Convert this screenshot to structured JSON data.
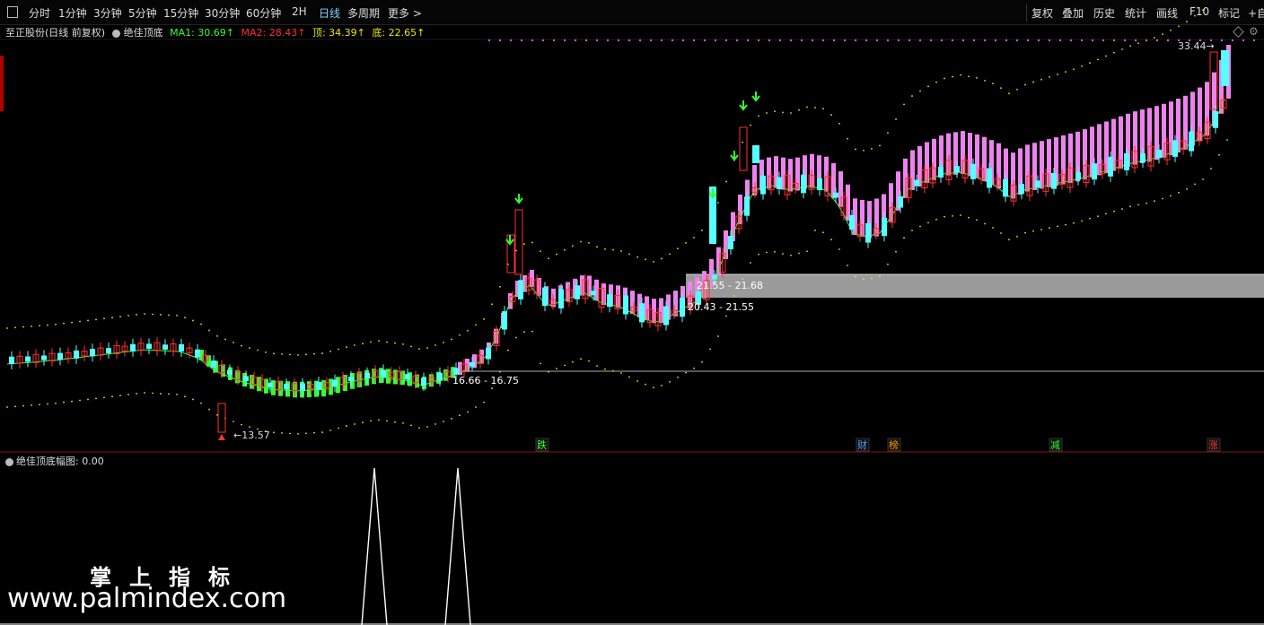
{
  "toolbar": {
    "periods": [
      "分时",
      "1分钟",
      "3分钟",
      "5分钟",
      "15分钟",
      "30分钟",
      "60分钟",
      "2H",
      "日线",
      "多周期",
      "更多 >"
    ],
    "active_period": "日线",
    "right_buttons": [
      "复权",
      "叠加",
      "历史",
      "统计",
      "画线",
      "F10",
      "标记",
      "+自"
    ]
  },
  "info": {
    "stock_name": "至正股份(日线 前复权)",
    "indicator": "绝佳顶底",
    "ma1": "MA1: 30.69↑",
    "ma2": "MA2: 28.43↑",
    "top": "顶: 34.39↑",
    "bottom": "底: 22.65↑"
  },
  "colors": {
    "up": "#ff3030",
    "down": "#54ffff",
    "band_up": "#ee82ee",
    "band_down": "#33ff33",
    "yellow": "#e8e800",
    "ma1": "#33ff33",
    "ma2": "#ff3030",
    "magenta_dot": "#ff55ff",
    "label_green": "#33ff33",
    "label_orange": "#ff9900",
    "label_blue": "#5599ff",
    "label_red": "#ff3030"
  },
  "annotations": {
    "low_mark": "13.57",
    "high_mark": "33.44",
    "range_a": "21.55 - 21.68",
    "range_b": "20.43 - 21.55",
    "range_c": "16.66 - 16.75"
  },
  "events": [
    {
      "label": "跌",
      "color": "#33ff33"
    },
    {
      "label": "财",
      "color": "#5599ff"
    },
    {
      "label": "榜",
      "color": "#ff9900"
    },
    {
      "label": "减",
      "color": "#33ff33"
    },
    {
      "label": "涨",
      "color": "#ff3030"
    }
  ],
  "sub_indicator": {
    "name": "绝佳顶底幅图",
    "value": ": 0.00"
  },
  "watermark": {
    "chinese": "掌上指标",
    "url": "www.palmindex.com"
  }
}
